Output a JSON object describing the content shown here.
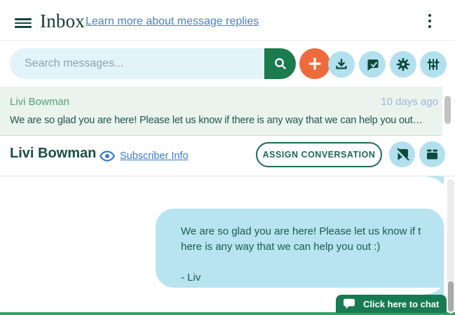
{
  "header": {
    "title": "Inbox",
    "link_label": "Learn more about message replies",
    "menu_icon": "hamburger-menu-icon",
    "overflow_icon": "kebab-menu-icon"
  },
  "toolbar": {
    "search_placeholder": "Search messages...",
    "icons": [
      "search-icon",
      "add-icon",
      "download-icon",
      "message-check-icon",
      "settings-gear-icon",
      "filter-sliders-icon"
    ]
  },
  "conversation_list": {
    "items": [
      {
        "name": "Livi Bowman",
        "timestamp": "10 days ago",
        "preview": "We are so glad you are here! Please let us know if there is any way that we can help you out…"
      }
    ]
  },
  "conversation_header": {
    "name": "Livi Bowman",
    "eye_icon": "eye-icon",
    "subscriber_info_label": "Subscriber Info",
    "assign_button_label": "ASSIGN CONVERSATION",
    "action_icons": [
      "mute-conversation-icon",
      "archive-box-icon"
    ]
  },
  "chat": {
    "messages": [
      {
        "direction": "outgoing",
        "text": "We are so glad you are here! Please let us know if t\nhere is any way that we can help you out :)\n\n- Liv"
      }
    ]
  },
  "chat_widget": {
    "label": "Click here to chat",
    "icon": "chat-bubble-icon"
  },
  "colors": {
    "brand_dark_green": "#14463a",
    "icon_green": "#0e4a3c",
    "search_button_green": "#1c7a4f",
    "accent_orange": "#ee6b3d",
    "light_blue_button": "#b2e0ee",
    "bubble_blue": "#b7e4f0",
    "link_blue": "#4a7fd0",
    "widget_green": "#187a52",
    "bottom_bar_green": "#33a263",
    "list_row_green": "#eaf3ec"
  }
}
